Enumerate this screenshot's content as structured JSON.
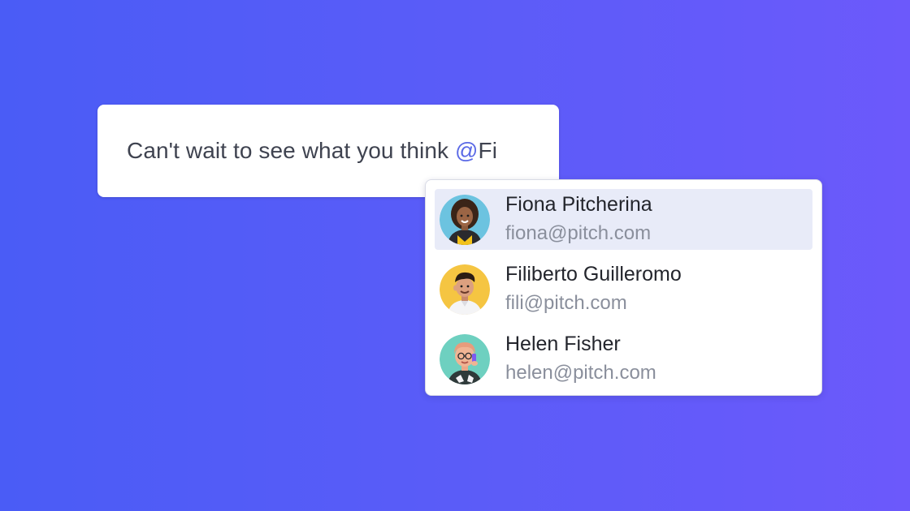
{
  "comment": {
    "text": "Can't wait to see what you think ",
    "mention_trigger": "@",
    "mention_query": "Fi"
  },
  "mention_suggestions": [
    {
      "name": "Fiona Pitcherina",
      "email": "fiona@pitch.com",
      "selected": true,
      "avatar": "fiona-avatar"
    },
    {
      "name": "Filiberto Guilleromo",
      "email": "fili@pitch.com",
      "selected": false,
      "avatar": "filiberto-avatar"
    },
    {
      "name": "Helen Fisher",
      "email": "helen@pitch.com",
      "selected": false,
      "avatar": "helen-avatar"
    }
  ],
  "colors": {
    "background_start": "#4a5cf6",
    "background_end": "#6c59fb",
    "mention_accent": "#5b6ae6",
    "selected_row": "#e8ebf8"
  }
}
